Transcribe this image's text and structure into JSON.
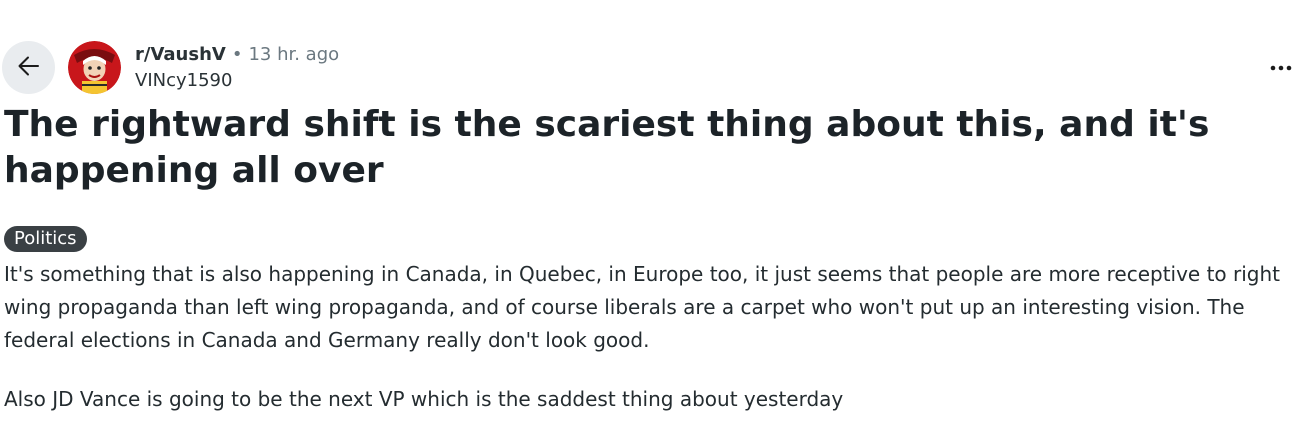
{
  "post": {
    "subreddit": "r/VaushV",
    "separator": "•",
    "time": "13 hr. ago",
    "author": "VINcy1590",
    "title": "The rightward shift is the scariest thing about this, and it's happening all over",
    "flair": "Politics",
    "paragraphs": [
      "It's something that is also happening in Canada, in Quebec, in Europe too, it just seems that people are more receptive to right wing propaganda than left wing propaganda, and of course liberals are a carpet who won't put up an interesting vision. The federal elections in Canada and Germany really don't look good.",
      "Also JD Vance is going to be the next VP which is the saddest thing about yesterday"
    ]
  },
  "icons": {
    "back": "arrow-left-icon",
    "more": "more-horizontal-icon"
  },
  "colors": {
    "back_button_bg": "#e9ecef",
    "flair_bg": "#3a4044",
    "avatar_red": "#c8161b"
  }
}
